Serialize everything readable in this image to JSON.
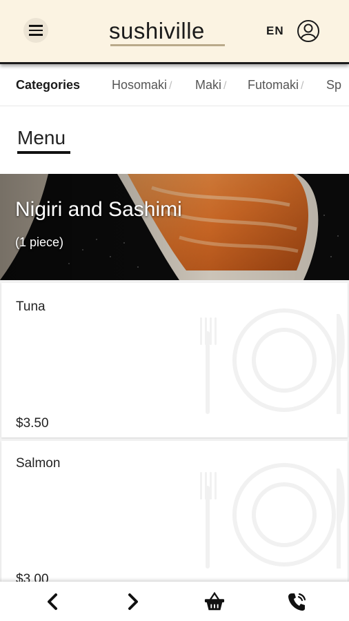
{
  "header": {
    "menu_icon": "hamburger-icon",
    "logo_text": "sushiville",
    "language": "EN",
    "user_icon": "user-icon",
    "colors": {
      "background": "#fbf3e2",
      "ink": "#1b1b1b"
    }
  },
  "categories": {
    "title": "Categories",
    "items": [
      "Hosomaki",
      "Maki",
      "Futomaki",
      "Sp"
    ]
  },
  "menu": {
    "heading": "Menu"
  },
  "section": {
    "title": "Nigiri and Sashimi",
    "subtitle": "(1 piece)"
  },
  "items": [
    {
      "name": "Tuna",
      "price": "$3.50"
    },
    {
      "name": "Salmon",
      "price": "$3.00"
    }
  ],
  "bottom_nav": {
    "icons": [
      "chevron-left-icon",
      "chevron-right-icon",
      "basket-icon",
      "phone-icon"
    ]
  }
}
